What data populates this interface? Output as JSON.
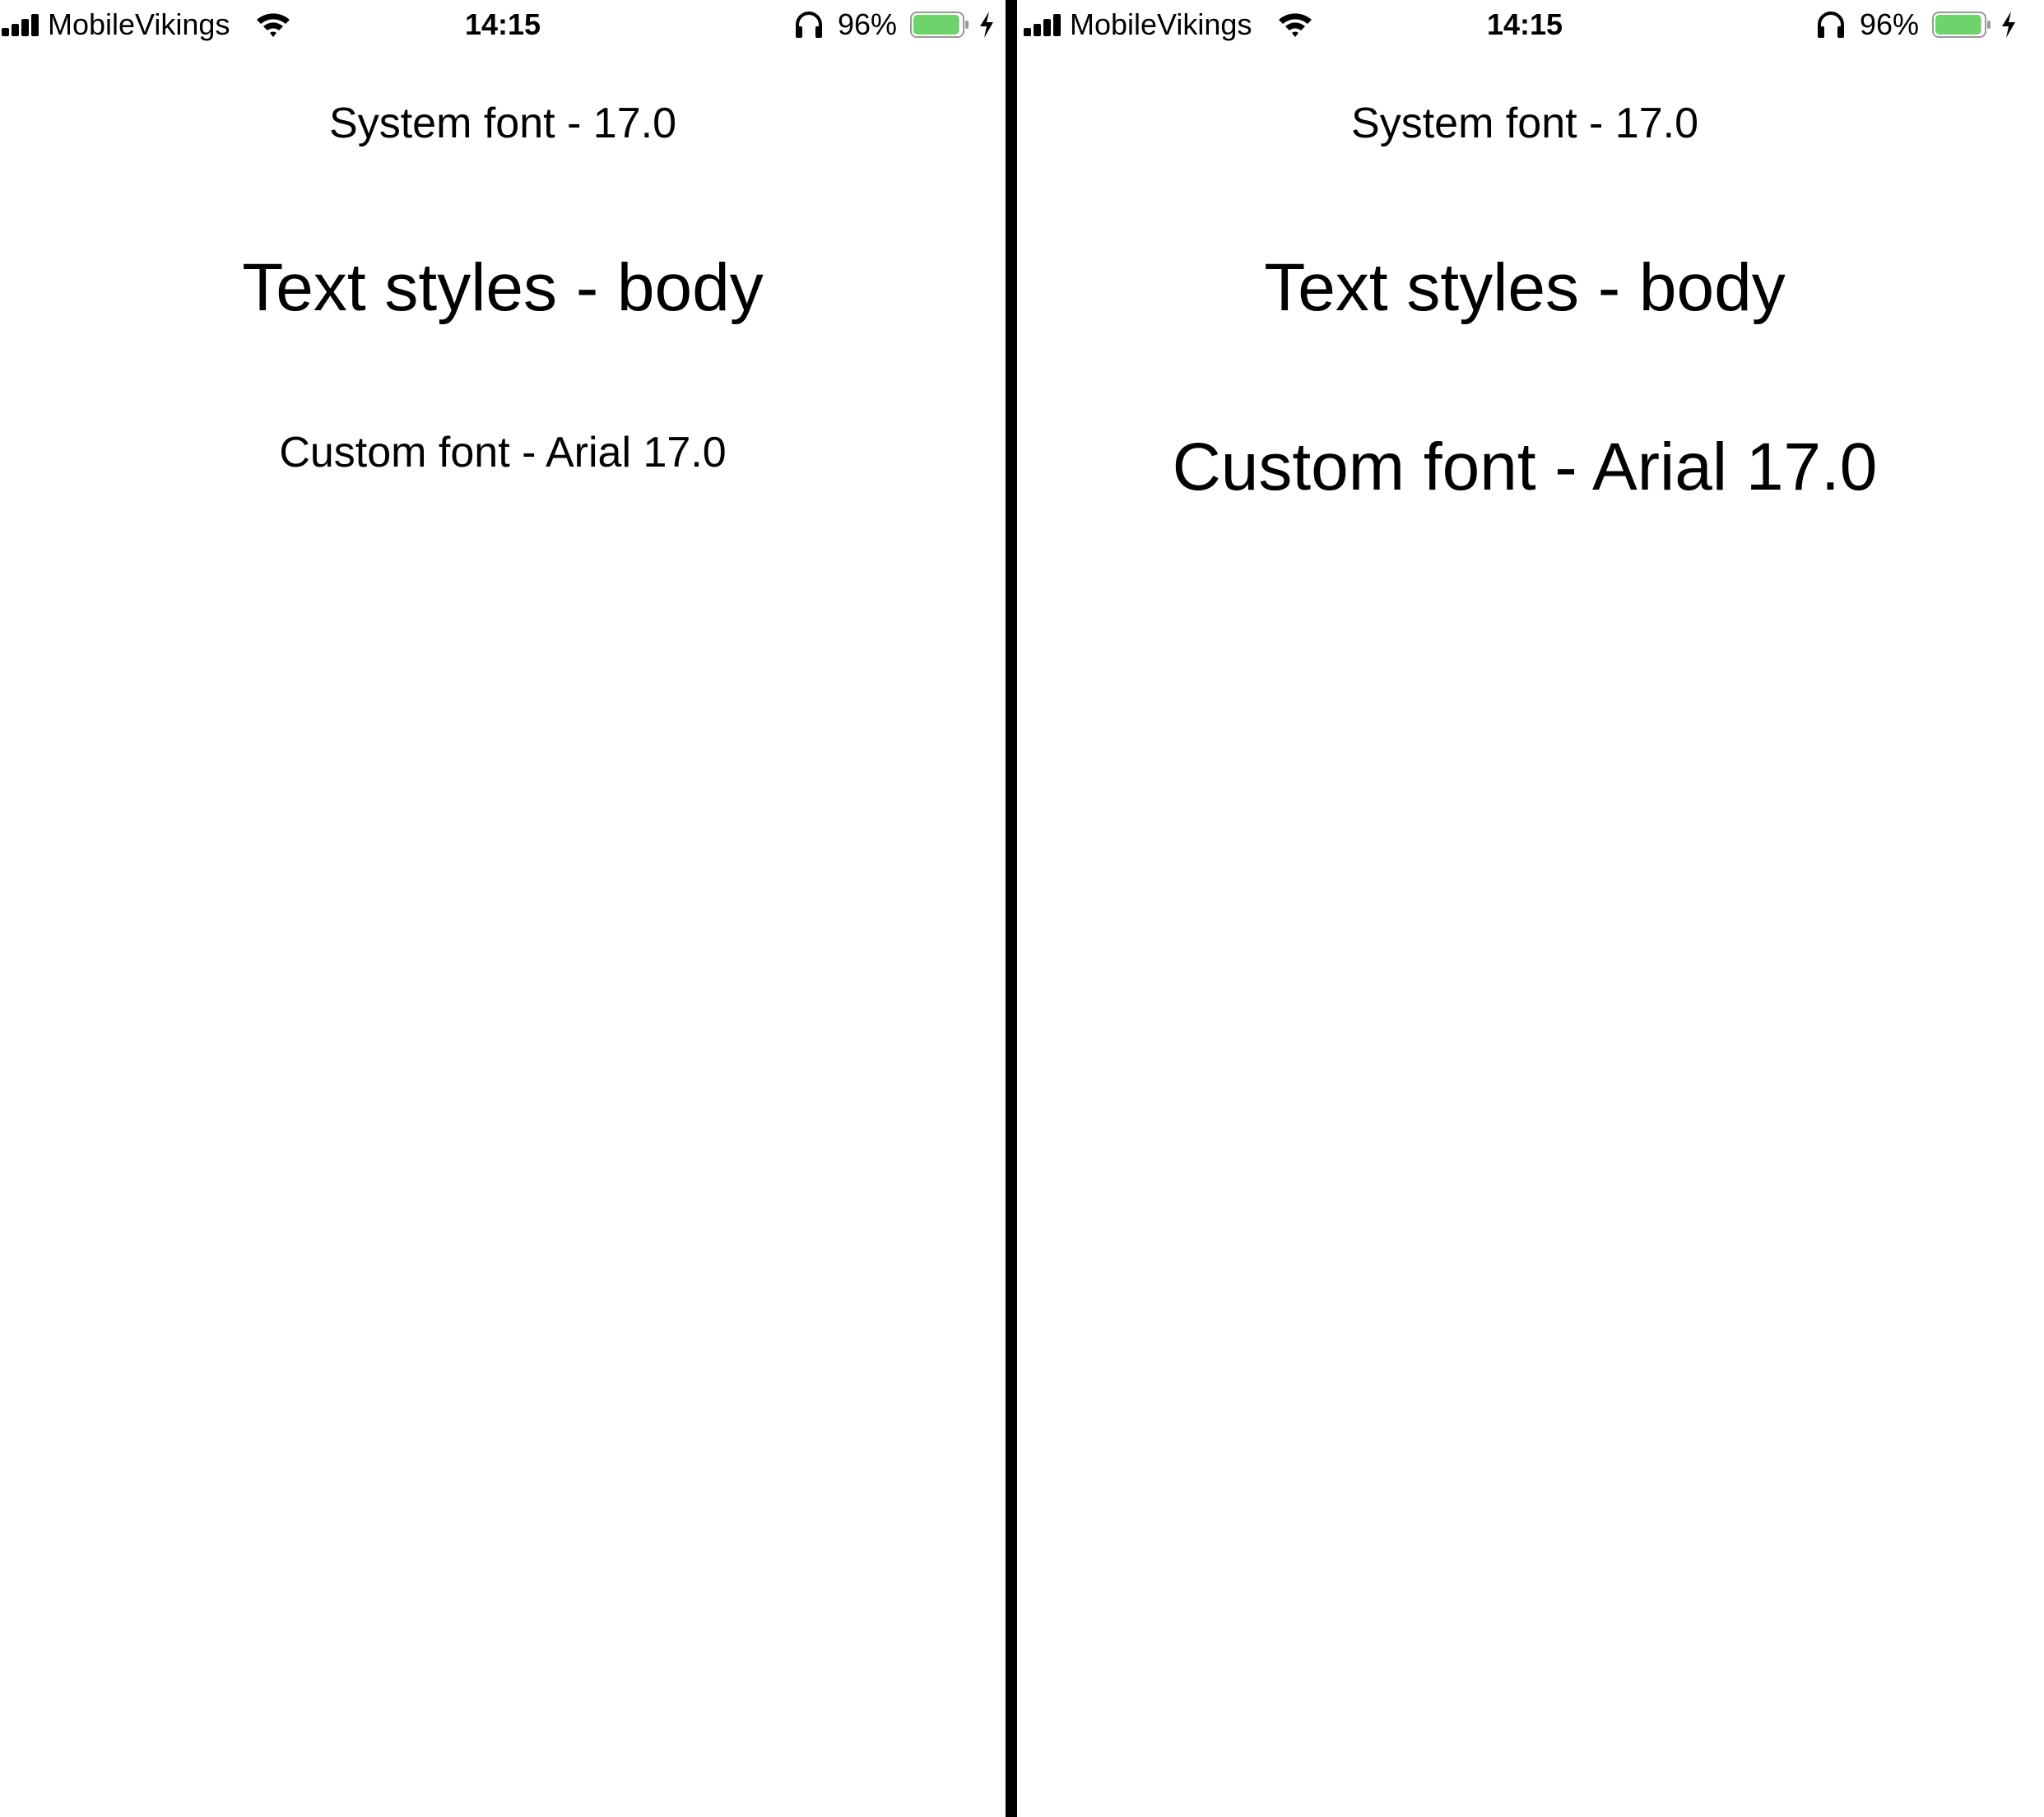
{
  "status_bar": {
    "carrier": "MobileVikings",
    "time": "14:15",
    "battery_percent": "96%",
    "battery_level": 0.96,
    "battery_color": "#6cd46a",
    "icons": [
      "cellular-signal-icon",
      "wifi-icon",
      "headphones-icon",
      "battery-icon",
      "charging-bolt-icon"
    ]
  },
  "screens": [
    {
      "system_font_label": "System font - 17.0",
      "text_style_label": "Text styles - body",
      "custom_font_label": "Custom font - Arial 17.0"
    },
    {
      "system_font_label": "System font - 17.0",
      "text_style_label": "Text styles - body",
      "custom_font_label": "Custom font - Arial 17.0"
    }
  ],
  "colors": {
    "background": "#ffffff",
    "text": "#000000",
    "divider": "#000000"
  }
}
